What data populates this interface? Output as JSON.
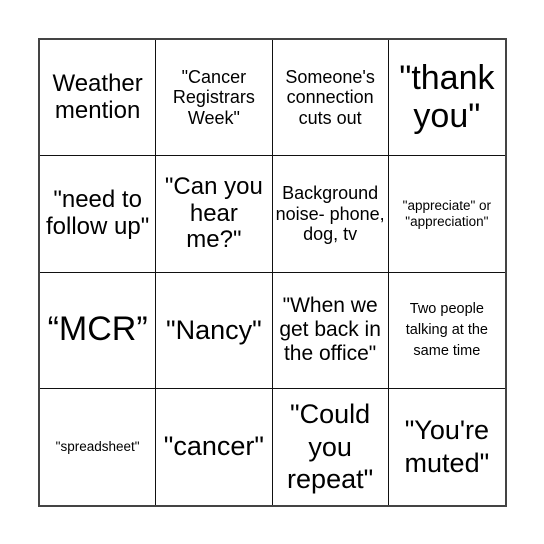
{
  "board": {
    "cells": [
      {
        "text": "Weather mention"
      },
      {
        "text": "\"Cancer Registrars Week\""
      },
      {
        "text": "Someone's connection cuts out"
      },
      {
        "text": "\"thank you\""
      },
      {
        "text": "\"need to follow up\""
      },
      {
        "text": "\"Can you hear me?\""
      },
      {
        "text": "Background noise- phone, dog, tv"
      },
      {
        "text": "\"appreciate\" or \"appreciation\""
      },
      {
        "text": "“MCR”"
      },
      {
        "text": "\"Nancy\""
      },
      {
        "text": "\"When we get back in the office\""
      },
      {
        "text": "Two people talking at the same time"
      },
      {
        "text": "\"spreadsheet\""
      },
      {
        "text": "\"cancer\""
      },
      {
        "text": "\"Could you repeat\""
      },
      {
        "text": "\"You're muted\""
      }
    ]
  },
  "colors": {
    "border": "#444444",
    "grid_line": "#111111",
    "background": "#ffffff",
    "text": "#000000"
  }
}
